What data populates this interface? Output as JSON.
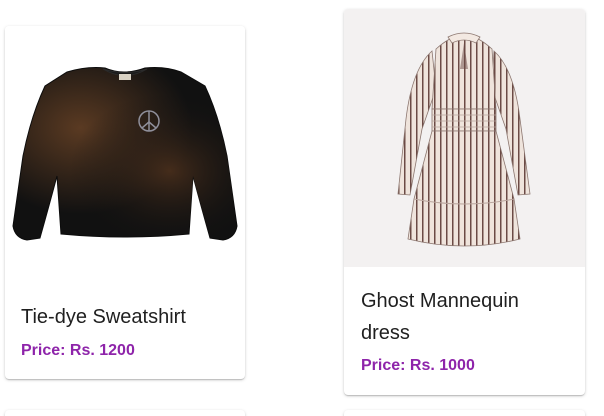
{
  "products": [
    {
      "name": "Tie-dye Sweatshirt",
      "price_label": "Price: Rs. 1200",
      "image_icon": "sweatshirt-image"
    },
    {
      "name": "Ghost Mannequin dress",
      "price_label": "Price: Rs. 1000",
      "image_icon": "dress-image"
    }
  ],
  "colors": {
    "price": "#8e24aa",
    "title": "#1f1f1f",
    "card_bg": "#ffffff"
  }
}
